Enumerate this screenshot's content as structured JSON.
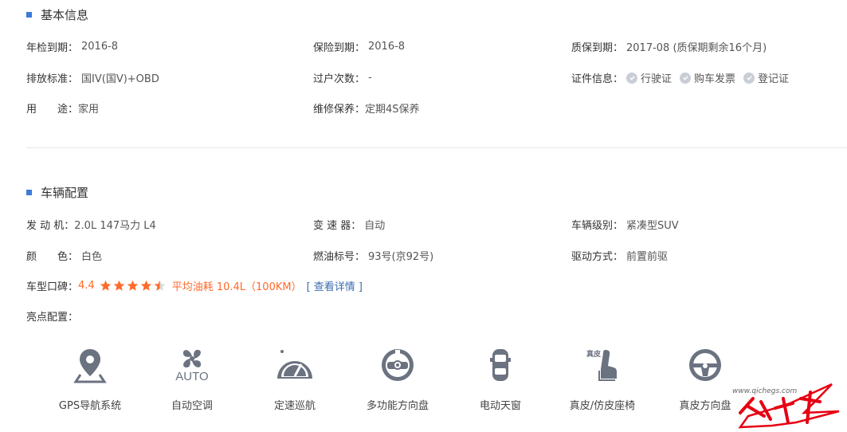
{
  "basic": {
    "title": "基本信息",
    "inspection_label": "年检到期：",
    "inspection_value": "2016-8",
    "insurance_label": "保险到期：",
    "insurance_value": "2016-8",
    "warranty_label": "质保到期：",
    "warranty_value": "2017-08 (质保期剩余16个月)",
    "emission_label": "排放标准：",
    "emission_value": "国IV(国V)+OBD",
    "transfer_label": "过户次数：",
    "transfer_value": "-",
    "docs_label": "证件信息：",
    "docs": [
      "行驶证",
      "购车发票",
      "登记证"
    ],
    "usage_label": "用　　途：",
    "usage_value": "家用",
    "maintenance_label": "维修保养：",
    "maintenance_value": "定期4S保养"
  },
  "config": {
    "title": "车辆配置",
    "engine_label": "发 动 机：",
    "engine_value": "2.0L 147马力 L4",
    "gearbox_label": "变 速 器：",
    "gearbox_value": "自动",
    "class_label": "车辆级别：",
    "class_value": "紧凑型SUV",
    "color_label": "颜　　色：",
    "color_value": "白色",
    "fuel_label": "燃油标号：",
    "fuel_value": "93号(京92号)",
    "drive_label": "驱动方式：",
    "drive_value": "前置前驱",
    "rating_label": "车型口碑：",
    "rating_value": "4.4",
    "rating_fraction": 0.88,
    "fuel_consumption": "平均油耗 10.4L（100KM）",
    "details_link": "[ 查看详情 ]",
    "highlights_label": "亮点配置："
  },
  "features": [
    {
      "label": "GPS导航系统",
      "icon": "gps-pin-icon"
    },
    {
      "label": "自动空调",
      "icon": "auto-ac-fan-icon",
      "icon_text": "AUTO"
    },
    {
      "label": "定速巡航",
      "icon": "cruise-gauge-icon"
    },
    {
      "label": "多功能方向盘",
      "icon": "multifunction-wheel-icon"
    },
    {
      "label": "电动天窗",
      "icon": "sunroof-car-icon"
    },
    {
      "label": "真皮/仿皮座椅",
      "icon": "leather-seat-icon",
      "icon_text": "真皮"
    },
    {
      "label": "真皮方向盘",
      "icon": "steering-wheel-icon"
    }
  ],
  "watermark": {
    "url": "www.qichegs.com",
    "brand": "汽车杠"
  },
  "colors": {
    "accent_blue": "#3c7bd7",
    "orange": "#ff6a2a",
    "icon_gray": "#6b7280",
    "link": "#3b6bb0"
  }
}
